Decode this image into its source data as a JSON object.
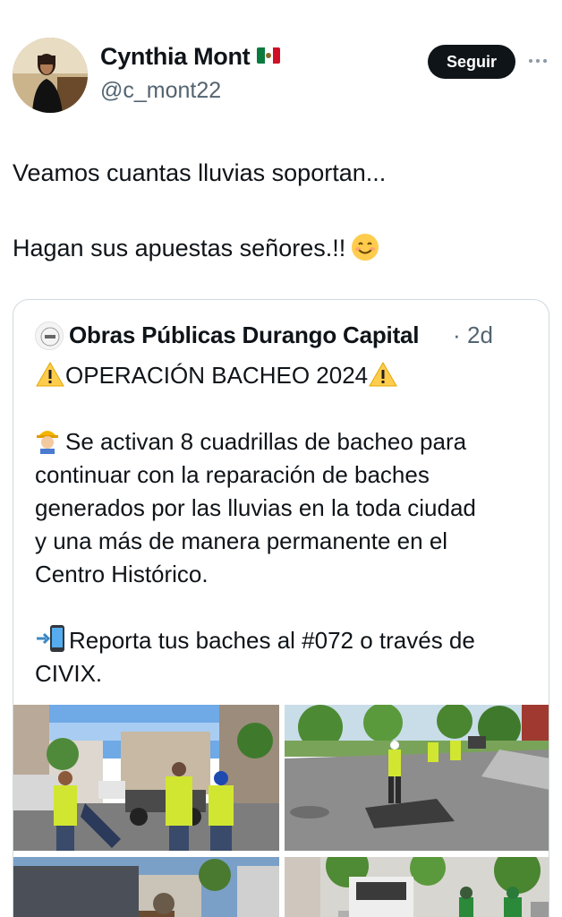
{
  "author": {
    "name": "Cynthia Mont",
    "flag_icon": "mexico-flag-icon",
    "handle": "@c_mont22"
  },
  "follow_button": "Seguir",
  "more_icon": "more-options-icon",
  "tweet": {
    "line1": "Veamos cuantas lluvias soportan...",
    "line2": "Hagan sus apuestas señores.!!",
    "emoji": "smiling-face-icon"
  },
  "quote": {
    "author_name": "Obras Públicas Durango Capital",
    "separator": "·",
    "time": "2d",
    "heading": "OPERACIÓN BACHEO 2024",
    "body_lines": [
      "Se activan 8 cuadrillas de bacheo para",
      "continuar con la reparación de baches",
      "generados por las lluvias en la toda ciudad",
      "y una más de manera permanente en el",
      "Centro Histórico."
    ],
    "report_lines": [
      "Reporta tus baches al #072 o través de",
      "CIVIX."
    ],
    "photos": [
      {
        "name": "photo-workers-truck"
      },
      {
        "name": "photo-pothole-street"
      },
      {
        "name": "photo-street-buildings"
      },
      {
        "name": "photo-pickup-crew"
      }
    ]
  },
  "colors": {
    "text": "#0f1419",
    "secondary": "#536471",
    "border": "#cfd9de",
    "button": "#0f1419"
  }
}
